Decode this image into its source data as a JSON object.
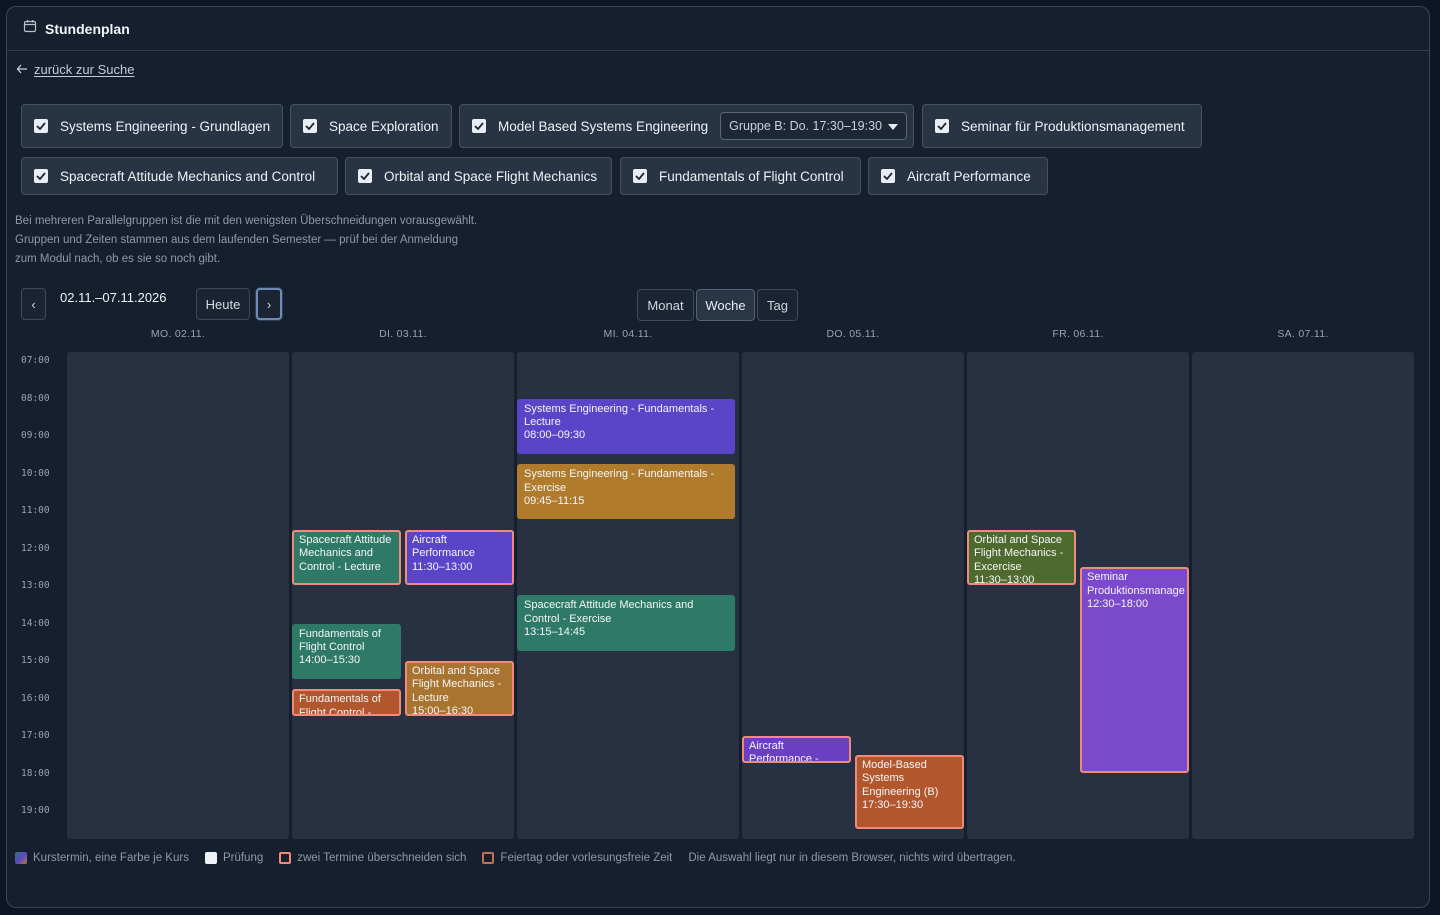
{
  "header": {
    "title": "Stundenplan",
    "icon": "calendar-icon"
  },
  "back_link": "zurück zur Suche",
  "courses": [
    {
      "label": "Systems Engineering - Grundlagen",
      "checked": true
    },
    {
      "label": "Space Exploration",
      "checked": true
    },
    {
      "label": "Model Based Systems Engineering",
      "checked": true,
      "group_select": "Gruppe B: Do. 17:30–19:30"
    },
    {
      "label": "Seminar für Produktionsmanagement",
      "checked": true
    },
    {
      "label": "Spacecraft Attitude Mechanics and Control",
      "checked": true
    },
    {
      "label": "Orbital and Space Flight Mechanics",
      "checked": true
    },
    {
      "label": "Fundamentals of Flight Control",
      "checked": true
    },
    {
      "label": "Aircraft Performance",
      "checked": true
    }
  ],
  "hint": {
    "line1": "Bei mehreren Parallelgruppen ist die mit den wenigsten Überschneidungen vorausgewählt.",
    "line2": "Gruppen und Zeiten stammen aus dem laufenden Semester — prüf bei der Anmeldung",
    "line3": "zum Modul nach, ob es sie so noch gibt."
  },
  "toolbar": {
    "prev": "‹",
    "date_range": "02.11.–07.11.2026",
    "today": "Heute",
    "next": "›",
    "views": [
      "Monat",
      "Woche",
      "Tag"
    ],
    "active_view": "Woche"
  },
  "days": [
    "MO. 02.11.",
    "DI. 03.11.",
    "MI. 04.11.",
    "DO. 05.11.",
    "FR. 06.11.",
    "SA. 07.11."
  ],
  "hours": [
    "07:00",
    "08:00",
    "09:00",
    "10:00",
    "11:00",
    "12:00",
    "13:00",
    "14:00",
    "15:00",
    "16:00",
    "17:00",
    "18:00",
    "19:00"
  ],
  "events": [
    {
      "day": 2,
      "title": "Systems Engineering - Fundamentals - Lecture",
      "time": "08:00–09:30",
      "start": 8.0,
      "end": 9.5,
      "lane": 0,
      "lanes": 1,
      "color": "#5a45c8",
      "conflict": false
    },
    {
      "day": 2,
      "title": "Systems Engineering - Fundamentals - Exercise",
      "time": "09:45–11:15",
      "start": 9.75,
      "end": 11.25,
      "lane": 0,
      "lanes": 1,
      "color": "#b07b2c",
      "conflict": false
    },
    {
      "day": 2,
      "title": "Spacecraft Attitude Mechanics and Control - Exercise",
      "time": "13:15–14:45",
      "start": 13.25,
      "end": 14.75,
      "lane": 0,
      "lanes": 1,
      "color": "#2e7a66",
      "conflict": false
    },
    {
      "day": 1,
      "title": "Spacecraft Attitude Mechanics and Control - Lecture",
      "time": "",
      "start": 11.5,
      "end": 13.0,
      "lane": 0,
      "lanes": 2,
      "color": "#2e7a66",
      "conflict": true
    },
    {
      "day": 1,
      "title": "Aircraft Performance",
      "time": "11:30–13:00",
      "start": 11.5,
      "end": 13.0,
      "lane": 1,
      "lanes": 2,
      "color": "#5a45c8",
      "conflict": true
    },
    {
      "day": 1,
      "title": "Fundamentals of Flight Control",
      "time": "14:00–15:30",
      "start": 14.0,
      "end": 15.5,
      "lane": 0,
      "lanes": 2,
      "color": "#2e7a66",
      "conflict": false
    },
    {
      "day": 1,
      "title": "Orbital and Space Flight Mechanics - Lecture",
      "time": "15:00–16:30",
      "start": 15.0,
      "end": 16.5,
      "lane": 1,
      "lanes": 2,
      "color": "#a87430",
      "conflict": true
    },
    {
      "day": 1,
      "title": "Fundamentals of Flight Control -",
      "time": "",
      "start": 15.75,
      "end": 16.5,
      "lane": 0,
      "lanes": 2,
      "color": "#b2562e",
      "conflict": true
    },
    {
      "day": 3,
      "title": "Aircraft Performance -",
      "time": "",
      "start": 17.0,
      "end": 17.75,
      "lane": 0,
      "lanes": 2,
      "color": "#6a3fc4",
      "conflict": true
    },
    {
      "day": 3,
      "title": "Model-Based Systems Engineering (B)",
      "time": "17:30–19:30",
      "start": 17.5,
      "end": 19.5,
      "lane": 1,
      "lanes": 2,
      "color": "#b2562e",
      "conflict": true
    },
    {
      "day": 4,
      "title": "Orbital and Space Flight Mechanics - Excercise",
      "time": "11:30–13:00",
      "start": 11.5,
      "end": 13.0,
      "lane": 0,
      "lanes": 2,
      "color": "#4f6a2e",
      "conflict": true
    },
    {
      "day": 4,
      "title": "Seminar Produktionsmanage",
      "time": "12:30–18:00",
      "start": 12.5,
      "end": 18.0,
      "lane": 1,
      "lanes": 2,
      "color": "#7b49cc",
      "conflict": true
    }
  ],
  "legend": {
    "course": "Kurstermin, eine Farbe je Kurs",
    "exam": "Prüfung",
    "overlap": "zwei Termine überschneiden sich",
    "holiday": "Feiertag oder vorlesungsfreie Zeit",
    "note": "Die Auswahl liegt nur in diesem Browser, nichts wird übertragen."
  },
  "colors": {
    "background": "#0d1624",
    "panel": "#151f2d",
    "day_column": "#283141",
    "conflict_border": "#f08a7a",
    "holiday_border": "#c0705a"
  }
}
